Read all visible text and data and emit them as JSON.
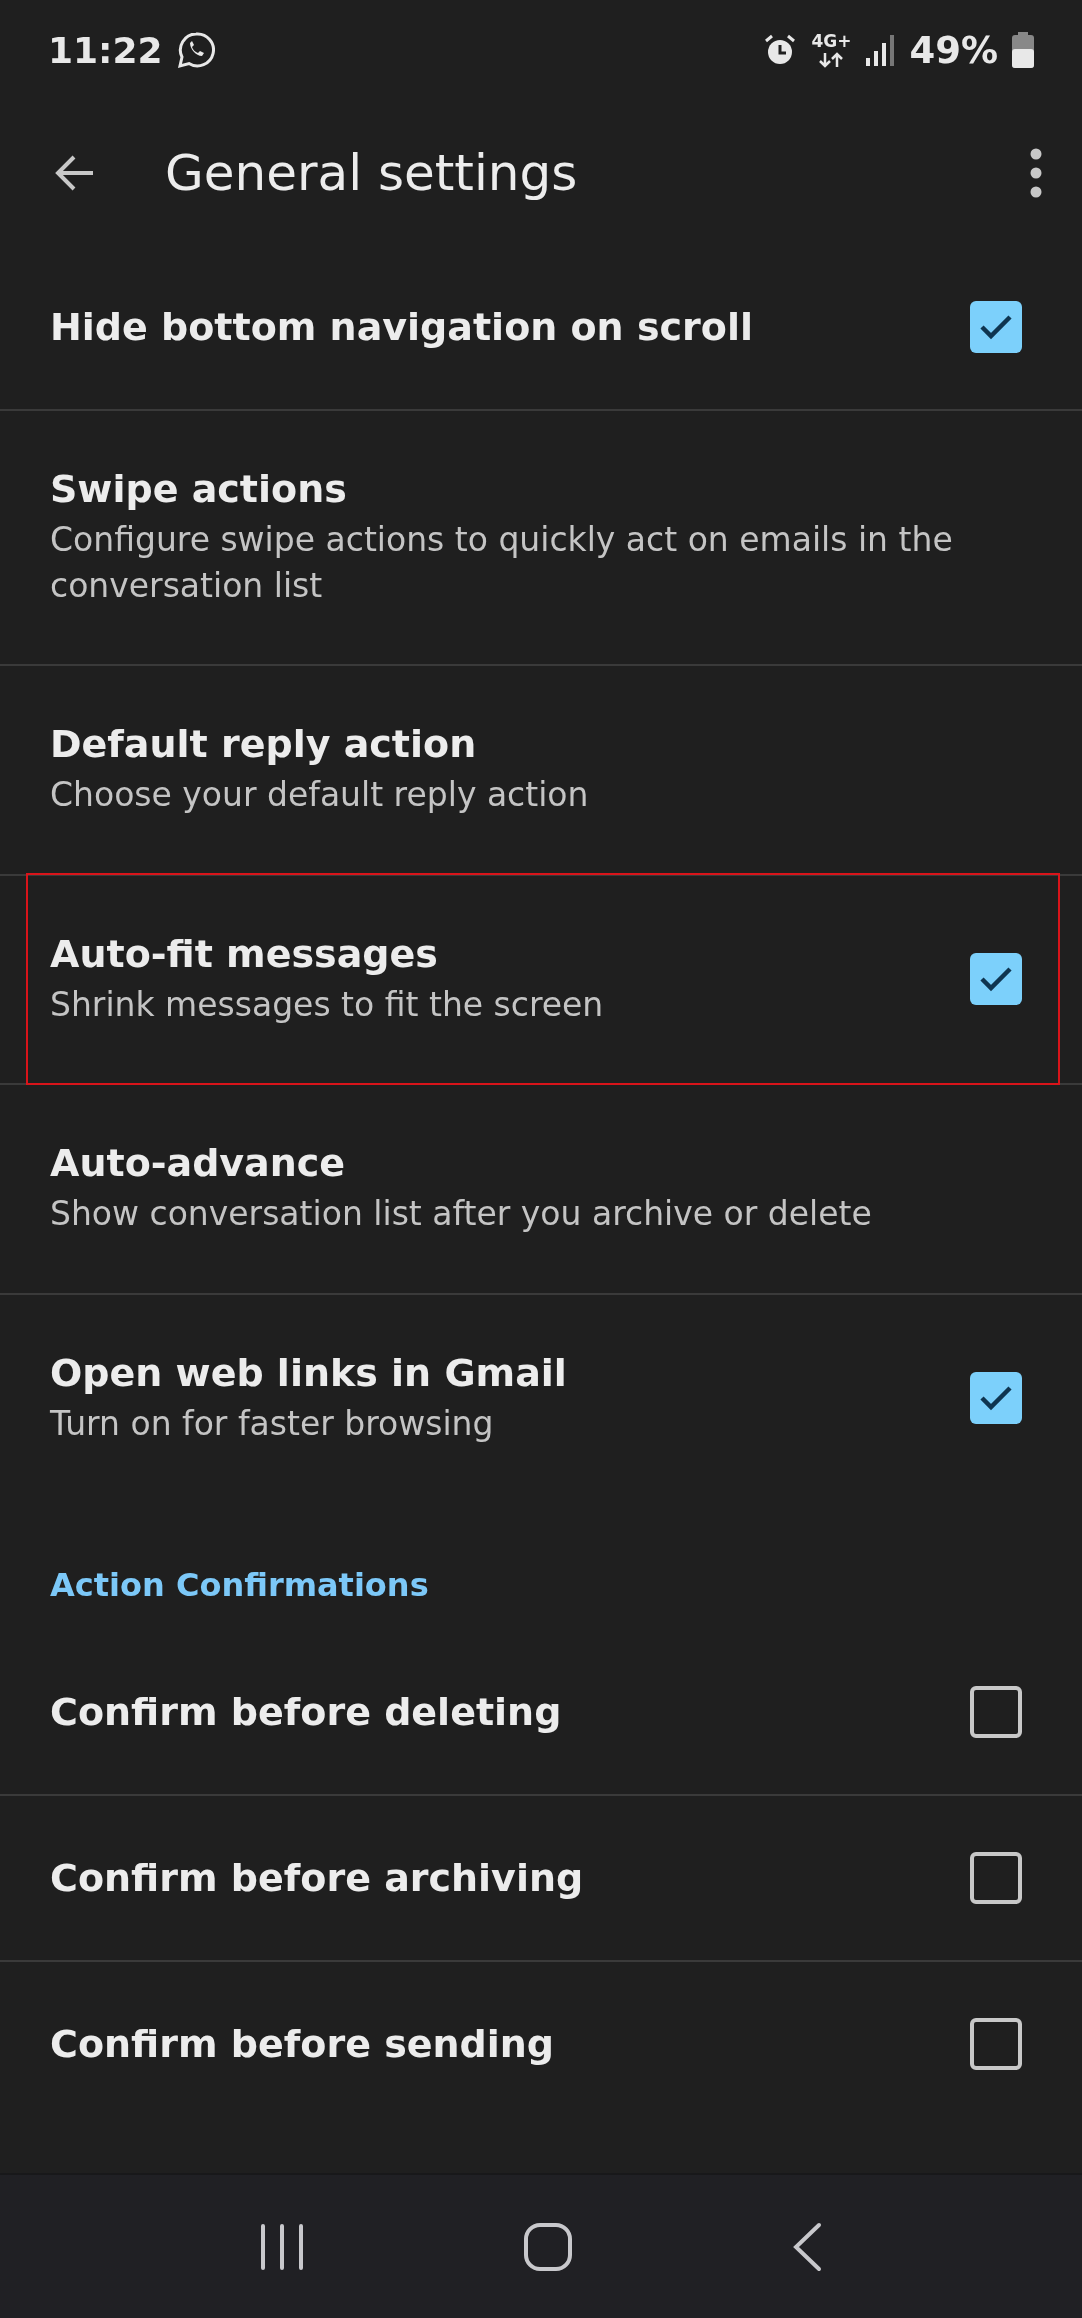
{
  "status_bar": {
    "time": "11:22",
    "network": "4G+",
    "battery": "49%"
  },
  "app_bar": {
    "title": "General settings"
  },
  "items": [
    {
      "kind": "checkbox",
      "title": "Hide bottom navigation on scroll",
      "checked": true,
      "highlighted": false
    },
    {
      "kind": "plain",
      "title": "Swipe actions",
      "subtitle": "Configure swipe actions to quickly act on emails in the conversation list",
      "highlighted": false
    },
    {
      "kind": "plain",
      "title": "Default reply action",
      "subtitle": "Choose your default reply action",
      "highlighted": false
    },
    {
      "kind": "checkbox",
      "title": "Auto-fit messages",
      "subtitle": "Shrink messages to fit the screen",
      "checked": true,
      "highlighted": true
    },
    {
      "kind": "plain",
      "title": "Auto-advance",
      "subtitle": "Show conversation list after you archive or delete",
      "highlighted": false
    },
    {
      "kind": "checkbox",
      "title": "Open web links in Gmail",
      "subtitle": "Turn on for faster browsing",
      "checked": true,
      "highlighted": false
    },
    {
      "kind": "header",
      "title": "Action Confirmations"
    },
    {
      "kind": "checkbox",
      "title": "Confirm before deleting",
      "checked": false,
      "highlighted": false
    },
    {
      "kind": "checkbox",
      "title": "Confirm before archiving",
      "checked": false,
      "highlighted": false
    },
    {
      "kind": "checkbox",
      "title": "Confirm before sending",
      "checked": false,
      "highlighted": false
    }
  ]
}
